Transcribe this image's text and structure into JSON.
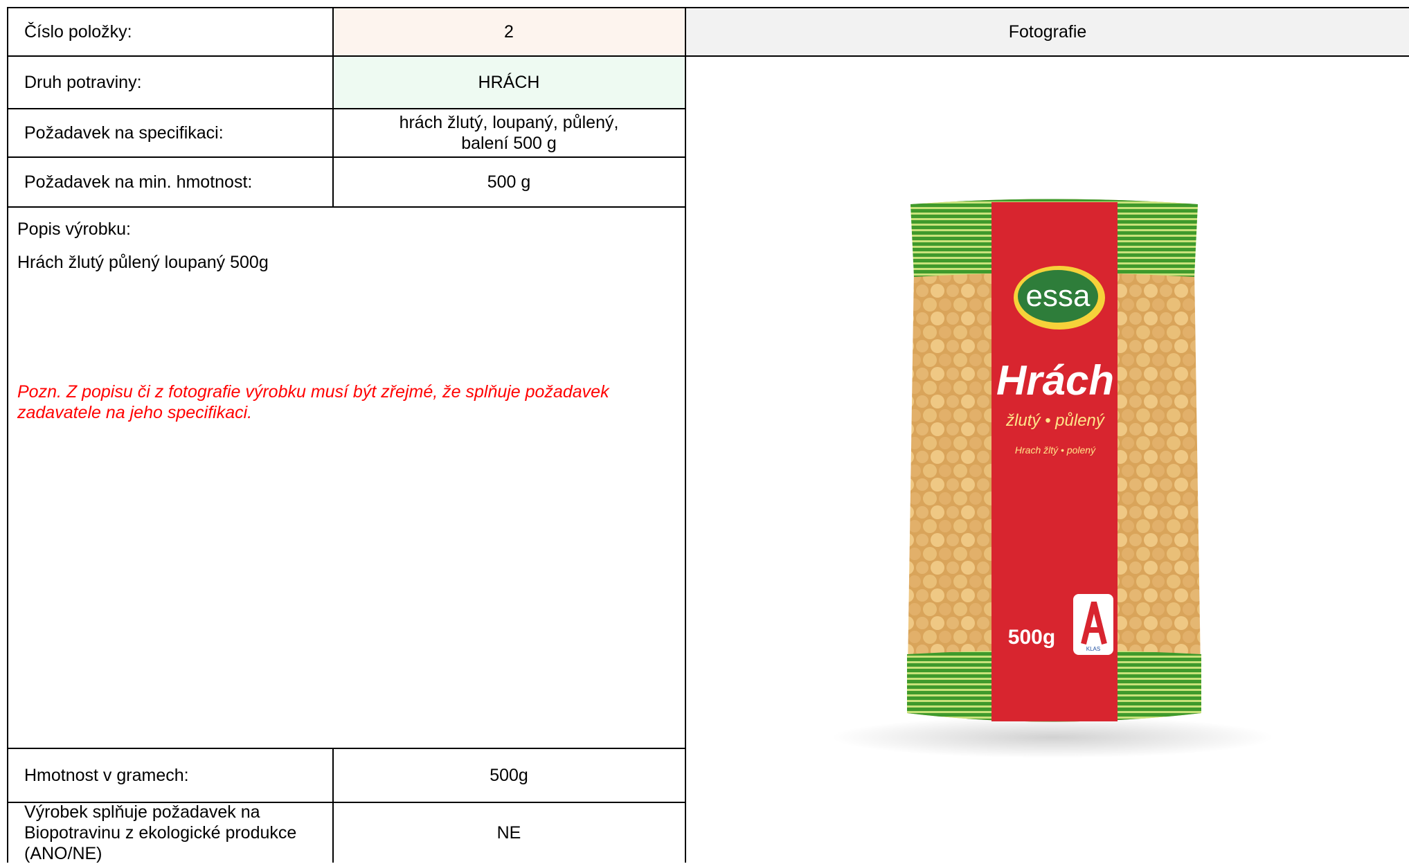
{
  "table": {
    "item_number_label": "Číslo položky:",
    "item_number_value": "2",
    "photo_header": "Fotografie",
    "food_type_label": "Druh potraviny:",
    "food_type_value": "HRÁCH",
    "spec_label": "Požadavek na specifikaci:",
    "spec_value_line1": "hrách žlutý, loupaný, půlený,",
    "spec_value_line2": "balení 500 g",
    "min_weight_label": "Požadavek na min. hmotnost:",
    "min_weight_value": "500 g",
    "description_label": "Popis výrobku:",
    "description_value": "Hrách žlutý půlený loupaný 500g",
    "note_line1": "Pozn. Z popisu či z fotografie výrobku musí být zřejmé, že splňuje požadavek",
    "note_line2": "zadavatele na jeho specifikaci.",
    "weight_grams_label": "Hmotnost v gramech:",
    "weight_grams_value": "500g",
    "bio_label_line1": "Výrobek splňuje požadavek na",
    "bio_label_line2": "Biopotravinu z ekologické produkce",
    "bio_label_line3": "(ANO/NE)",
    "bio_value": "NE"
  },
  "product_photo": {
    "brand": "essa",
    "title": "Hrách",
    "subtitle": "žlutý • půlený",
    "subtitle2": "Hrach žltý • polený",
    "weight": "500g",
    "quality_mark": "KLAS"
  },
  "colors": {
    "header_number_bg": "#fdf4ee",
    "food_type_bg": "#eefaf2",
    "photo_header_bg": "#f2f2f2",
    "note_text": "#ff0000",
    "pack_green": "#4aa632",
    "pack_red": "#d8252f"
  }
}
